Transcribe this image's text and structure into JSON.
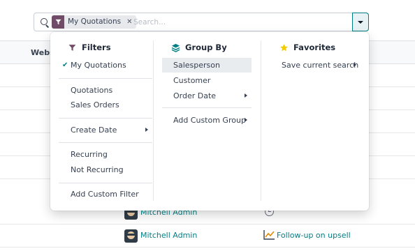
{
  "search": {
    "facet_label": "My Quotations",
    "placeholder": "Search..."
  },
  "list": {
    "column_header": "Webs",
    "rows": [
      {
        "salesperson": "Mitchell Admin",
        "activity": ""
      },
      {
        "salesperson": "Mitchell Admin",
        "activity": "Follow-up on upsell"
      }
    ]
  },
  "dropdown": {
    "filters": {
      "title": "Filters",
      "my_quotations": "My Quotations",
      "quotations": "Quotations",
      "sales_orders": "Sales Orders",
      "create_date": "Create Date",
      "recurring": "Recurring",
      "not_recurring": "Not Recurring",
      "add_custom_filter": "Add Custom Filter"
    },
    "group_by": {
      "title": "Group By",
      "salesperson": "Salesperson",
      "customer": "Customer",
      "order_date": "Order Date",
      "add_custom_group": "Add Custom Group"
    },
    "favorites": {
      "title": "Favorites",
      "save_current_search": "Save current search"
    }
  },
  "colors": {
    "accent": "#017e84",
    "brand": "#714b67",
    "star": "#f3cc00",
    "highlight": "#e9ecef"
  },
  "icons": {
    "search": "search-icon",
    "facet": "filter-icon",
    "toggle": "caret-down-icon",
    "filters_title": "filter-icon",
    "group_title": "layers-icon",
    "favorites_title": "star-icon",
    "checked": "check-icon",
    "submenu": "caret-right-icon",
    "activity_planned": "clock-icon",
    "activity_upsell": "chart-line-icon"
  }
}
